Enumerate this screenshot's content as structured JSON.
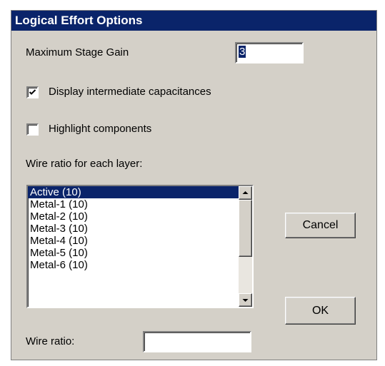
{
  "dialog": {
    "title": "Logical Effort Options",
    "stage_gain": {
      "label": "Maximum Stage Gain",
      "value": "3"
    },
    "display_caps": {
      "label": "Display intermediate capacitances",
      "checked": true
    },
    "highlight": {
      "label": "Highlight components",
      "checked": false
    },
    "wire_ratio_layers_label": "Wire ratio for each layer:",
    "layers": [
      "Active (10)",
      "Metal-1 (10)",
      "Metal-2 (10)",
      "Metal-3 (10)",
      "Metal-4 (10)",
      "Metal-5 (10)",
      "Metal-6 (10)"
    ],
    "selected_layer_index": 0,
    "wire_ratio": {
      "label": "Wire ratio:",
      "value": ""
    },
    "buttons": {
      "cancel": "Cancel",
      "ok": "OK"
    }
  },
  "colors": {
    "dialog_bg": "#d4d0c8",
    "selection": "#0a246a"
  }
}
